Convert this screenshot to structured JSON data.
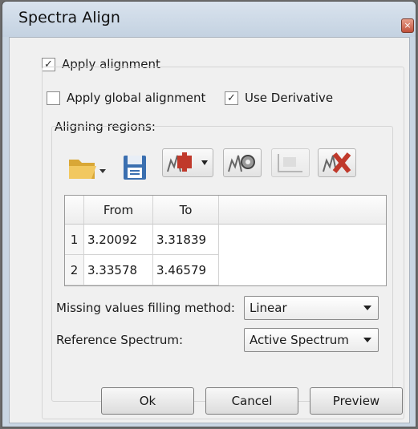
{
  "window": {
    "title": "Spectra Align",
    "close_glyph": "×"
  },
  "options": {
    "apply_alignment": {
      "label": "Apply alignment",
      "checked": true
    },
    "apply_global_alignment": {
      "label": "Apply global alignment",
      "checked": false
    },
    "use_derivative": {
      "label": "Use Derivative",
      "checked": true
    }
  },
  "regions": {
    "label": "Aligning regions:",
    "toolbar": [
      {
        "icon": "folder-open-icon"
      },
      {
        "icon": "save-icon"
      },
      {
        "icon": "add-region-icon"
      },
      {
        "icon": "region-settings-icon"
      },
      {
        "icon": "region-disabled-icon"
      },
      {
        "icon": "delete-region-icon"
      }
    ],
    "columns": [
      "From",
      "To"
    ],
    "rows": [
      {
        "num": "1",
        "from": "3.20092",
        "to": "3.31839"
      },
      {
        "num": "2",
        "from": "3.33578",
        "to": "3.46579"
      }
    ]
  },
  "missing_values": {
    "label": "Missing values filling method:",
    "value": "Linear"
  },
  "reference": {
    "label": "Reference Spectrum:",
    "value": "Active Spectrum"
  },
  "buttons": {
    "ok": "Ok",
    "cancel": "Cancel",
    "preview": "Preview"
  },
  "colors": {
    "accent": "#c9d6e3",
    "icon_red": "#c0392b",
    "folder": "#e8b84a",
    "save_blue": "#3a6fb0"
  }
}
